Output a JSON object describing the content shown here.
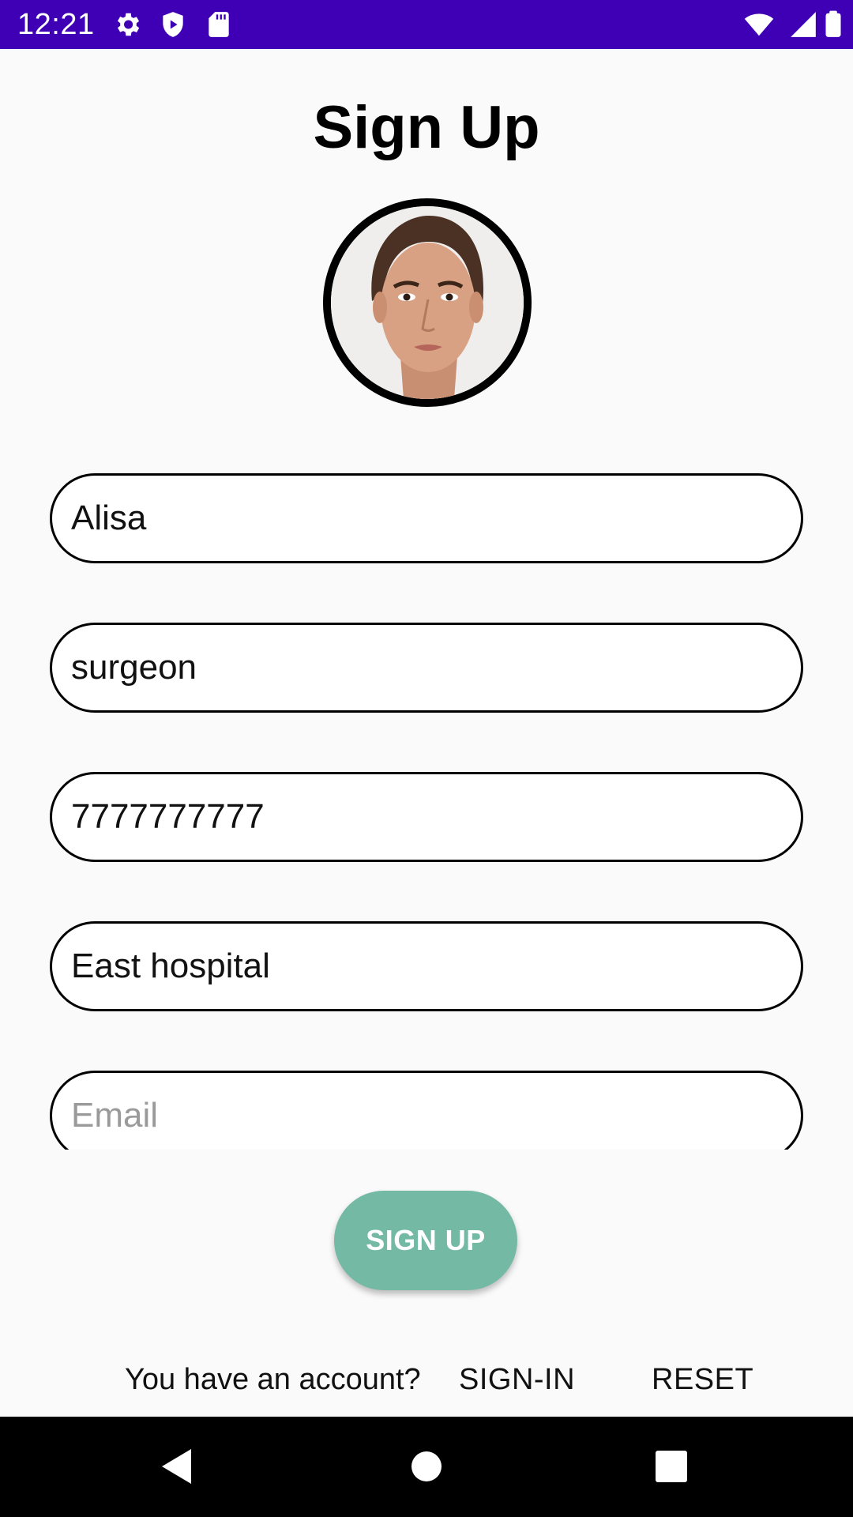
{
  "status_bar": {
    "time": "12:21",
    "icons": [
      "gear-icon",
      "shield-icon",
      "sd-card-icon",
      "wifi-icon",
      "signal-icon",
      "battery-icon"
    ],
    "background": "#3f00b5"
  },
  "title": "Sign Up",
  "avatar": {
    "icon": "profile-photo"
  },
  "form": {
    "name": {
      "value": "Alisa",
      "placeholder": ""
    },
    "profession": {
      "value": "surgeon",
      "placeholder": ""
    },
    "phone": {
      "value": "7777777777",
      "placeholder": ""
    },
    "hospital": {
      "value": "East hospital",
      "placeholder": ""
    },
    "email": {
      "value": "",
      "placeholder": "Email"
    }
  },
  "signup_button": {
    "label": "SIGN UP",
    "color": "#74b9a3"
  },
  "footer": {
    "question": "You have an account?",
    "signin_label": "SIGN-IN",
    "reset_label": "RESET"
  },
  "nav_bar": {
    "icons": [
      "back-icon",
      "home-icon",
      "recents-icon"
    ]
  }
}
